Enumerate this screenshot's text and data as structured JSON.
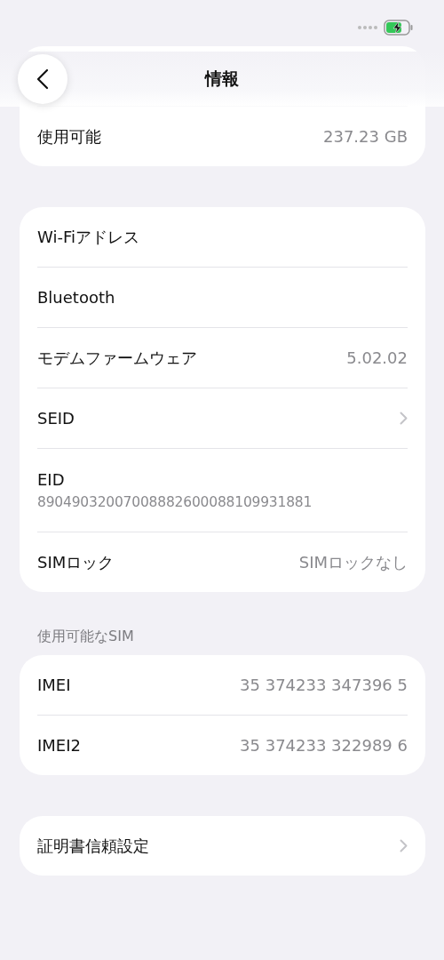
{
  "nav": {
    "title": "情報"
  },
  "sections": [
    {
      "rows": [
        {
          "kind": "value",
          "label": "使用可能",
          "value": "237.23 GB"
        }
      ]
    },
    {
      "rows": [
        {
          "kind": "plain",
          "label": "Wi-Fiアドレス"
        },
        {
          "kind": "plain",
          "label": "Bluetooth"
        },
        {
          "kind": "value",
          "label": "モデムファームウェア",
          "value": "5.02.02"
        },
        {
          "kind": "chevron",
          "label": "SEID"
        },
        {
          "kind": "subtitle",
          "label": "EID",
          "value": "89049032007008882600088109931881"
        },
        {
          "kind": "value",
          "label": "SIMロック",
          "value": "SIMロックなし"
        }
      ]
    },
    {
      "header": "使用可能なSIM",
      "rows": [
        {
          "kind": "value",
          "label": "IMEI",
          "value": "35 374233 347396 5"
        },
        {
          "kind": "value",
          "label": "IMEI2",
          "value": "35 374233 322989 6"
        }
      ]
    },
    {
      "rows": [
        {
          "kind": "chevron",
          "label": "証明書信頼設定"
        }
      ]
    }
  ]
}
